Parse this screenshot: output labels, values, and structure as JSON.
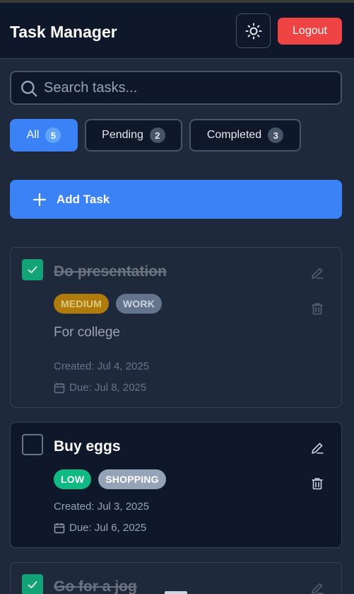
{
  "header": {
    "title": "Task Manager",
    "theme_icon": "sun-icon",
    "logout_label": "Logout"
  },
  "search": {
    "placeholder": "Search tasks...",
    "value": ""
  },
  "filters": [
    {
      "label": "All",
      "count": "5",
      "active": true
    },
    {
      "label": "Pending",
      "count": "2",
      "active": false
    },
    {
      "label": "Completed",
      "count": "3",
      "active": false
    }
  ],
  "add_task_label": "Add Task",
  "tasks": [
    {
      "title": "Do presentation",
      "completed": true,
      "priority": "MEDIUM",
      "category": "WORK",
      "description": "For college",
      "created": "Created: Jul 4, 2025",
      "due": "Due: Jul 8, 2025"
    },
    {
      "title": "Buy eggs",
      "completed": false,
      "priority": "LOW",
      "category": "SHOPPING",
      "description": "",
      "created": "Created: Jul 3, 2025",
      "due": "Due: Jul 6, 2025"
    },
    {
      "title": "Go for a jog",
      "completed": true
    }
  ],
  "colors": {
    "background": "#1e293b",
    "header": "#0f172a",
    "accent": "#3b82f6",
    "danger": "#ef4444",
    "check": "#10b981",
    "medium": "#ca8a04",
    "low": "#10b981",
    "category": "#94a3b8"
  }
}
